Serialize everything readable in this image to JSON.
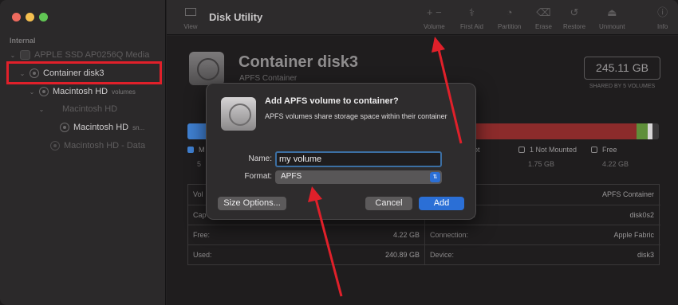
{
  "window": {
    "title": "Disk Utility"
  },
  "toolbar": {
    "view_label": "View",
    "buttons": [
      {
        "label": "Volume",
        "icon": "plus-minus-icon"
      },
      {
        "label": "First Aid",
        "icon": "stethoscope-icon"
      },
      {
        "label": "Partition",
        "icon": "pie-icon"
      },
      {
        "label": "Erase",
        "icon": "erase-icon"
      },
      {
        "label": "Restore",
        "icon": "restore-icon"
      },
      {
        "label": "Unmount",
        "icon": "eject-icon"
      },
      {
        "label": "Info",
        "icon": "info-icon"
      }
    ]
  },
  "sidebar": {
    "section": "Internal",
    "items": [
      {
        "label": "APPLE SSD AP0256Q Media",
        "sub": ""
      },
      {
        "label": "Container disk3",
        "sub": ""
      },
      {
        "label": "Macintosh HD",
        "sub": "volumes"
      },
      {
        "label": "Macintosh HD",
        "sub": ""
      },
      {
        "label": "Macintosh HD",
        "sub": "sn..."
      },
      {
        "label": "Macintosh HD - Data",
        "sub": ""
      }
    ]
  },
  "content": {
    "title": "Container disk3",
    "subtitle": "APFS Container",
    "capacity": "245.11 GB",
    "capacity_sub": "SHARED BY 5 VOLUMES",
    "legend": [
      {
        "label": "M",
        "value": "5",
        "color": "#3f7fd0"
      },
      {
        "label": "ot",
        "value": "",
        "color": "#8a8889"
      },
      {
        "label": "1 Not Mounted",
        "value": "1.75 GB",
        "color": "#8a8889"
      },
      {
        "label": "Free",
        "value": "4.22 GB",
        "color": "#8a8889"
      }
    ],
    "info": {
      "left": [
        {
          "label": "Vol",
          "value": ""
        },
        {
          "label": "Cap",
          "value": ""
        },
        {
          "label": "Free:",
          "value": "4.22 GB"
        },
        {
          "label": "Used:",
          "value": "240.89 GB"
        }
      ],
      "right": [
        {
          "label": "",
          "value": "APFS Container"
        },
        {
          "label": "s:",
          "value": "disk0s2"
        },
        {
          "label": "Connection:",
          "value": "Apple Fabric"
        },
        {
          "label": "Device:",
          "value": "disk3"
        }
      ]
    }
  },
  "dialog": {
    "title": "Add APFS volume to container?",
    "message": "APFS volumes share storage space within their container",
    "name_label": "Name:",
    "name_value": "my volume",
    "format_label": "Format:",
    "format_value": "APFS",
    "size_options_label": "Size Options...",
    "cancel_label": "Cancel",
    "add_label": "Add"
  },
  "colors": {
    "accent": "#2b6fd6",
    "annotation": "#e0202a",
    "bar_used": "#8c2b2b",
    "bar_other": "#5f8f3a"
  }
}
